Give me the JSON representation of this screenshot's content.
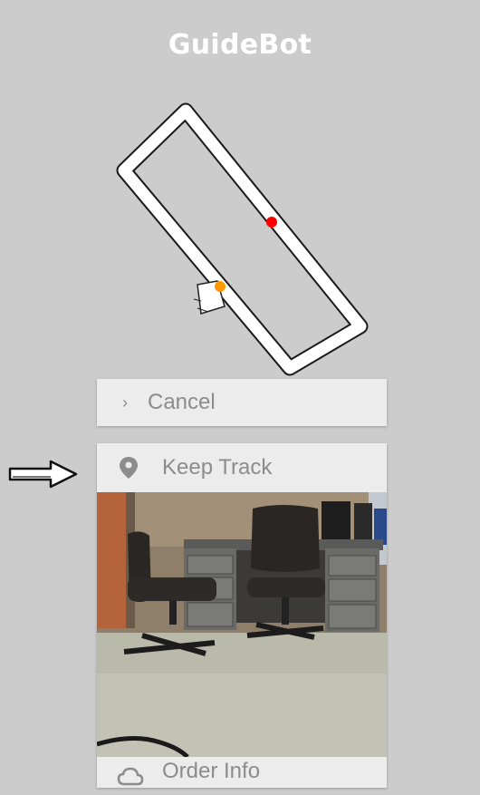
{
  "app": {
    "title": "GuideBot"
  },
  "map": {
    "path_color": "#ffffff",
    "current_position_color": "#ff0000",
    "destination_color": "#ff9900"
  },
  "menu": {
    "cancel": {
      "icon": "chevron-right-icon",
      "label": "Cancel"
    },
    "keep_track": {
      "icon": "location-pin-icon",
      "label": "Keep Track"
    },
    "order_info": {
      "icon": "cloud-icon",
      "label": "Order Info"
    }
  },
  "annotation": {
    "icon": "pointer-arrow-icon"
  }
}
